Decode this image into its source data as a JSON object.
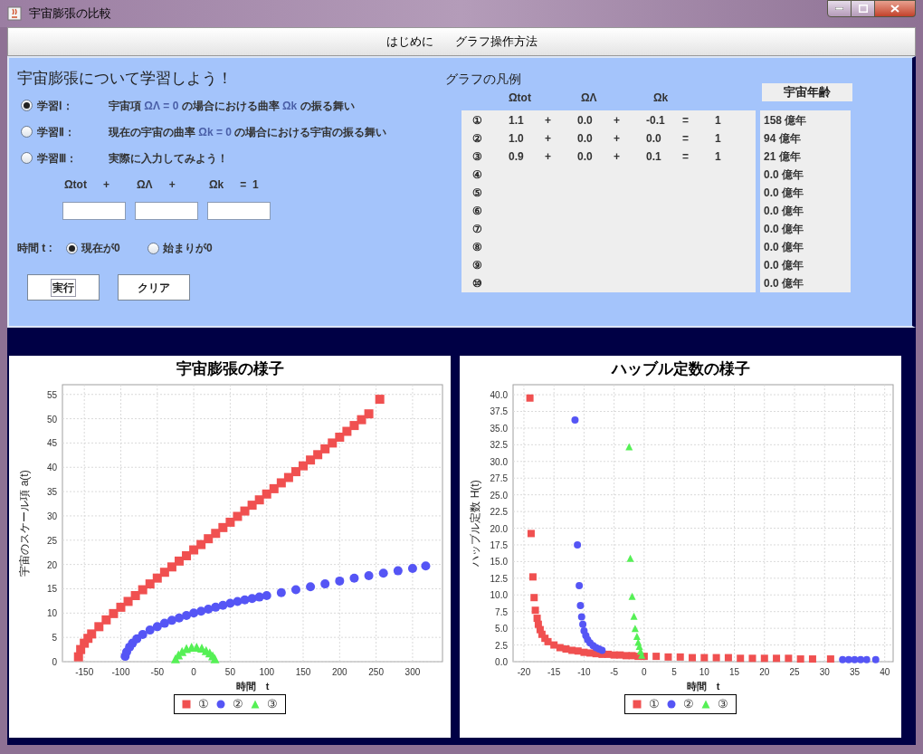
{
  "window": {
    "title": "宇宙膨張の比較"
  },
  "menu": [
    {
      "label": "はじめに"
    },
    {
      "label": "グラフ操作方法"
    }
  ],
  "study": {
    "heading": "宇宙膨張について学習しよう！",
    "lessons": [
      {
        "label": "学習Ⅰ：",
        "selected": true,
        "segments": [
          {
            "kind": "plain",
            "text": "宇宙項 "
          },
          {
            "kind": "symbol",
            "text": "ΩΛ = 0"
          },
          {
            "kind": "plain",
            "text": " の場合における曲率 "
          },
          {
            "kind": "symbol",
            "text": "Ωk"
          },
          {
            "kind": "plain",
            "text": " の振る舞い"
          }
        ]
      },
      {
        "label": "学習Ⅱ：",
        "selected": false,
        "segments": [
          {
            "kind": "plain",
            "text": "現在の宇宙の曲率 "
          },
          {
            "kind": "symbol",
            "text": "Ωk = 0"
          },
          {
            "kind": "plain",
            "text": " の場合における宇宙の振る舞い"
          }
        ]
      },
      {
        "label": "学習Ⅲ：",
        "selected": false,
        "segments": [
          {
            "kind": "plain",
            "text": "実際に入力してみよう！"
          }
        ]
      }
    ],
    "equation_labels": [
      "Ωtot",
      "+",
      "ΩΛ",
      "+",
      "Ωk",
      "=  1"
    ],
    "time_label": "時間 t :",
    "time_options": [
      {
        "label": "現在が0",
        "selected": true
      },
      {
        "label": "始まりが0",
        "selected": false
      }
    ],
    "buttons": [
      {
        "label": "実行",
        "focused": true
      },
      {
        "label": "クリア",
        "focused": false
      }
    ]
  },
  "legend": {
    "title": "グラフの凡例",
    "columns": [
      "Ωtot",
      "ΩΛ",
      "Ωk"
    ],
    "age_header": "宇宙年齢",
    "rows": [
      {
        "mark": "①",
        "terms": [
          "1.1",
          "+",
          "0.0",
          "+",
          "-0.1",
          "=",
          "1"
        ]
      },
      {
        "mark": "②",
        "terms": [
          "1.0",
          "+",
          "0.0",
          "+",
          "0.0",
          "=",
          "1"
        ]
      },
      {
        "mark": "③",
        "terms": [
          "0.9",
          "+",
          "0.0",
          "+",
          "0.1",
          "=",
          "1"
        ]
      },
      {
        "mark": "④",
        "terms": []
      },
      {
        "mark": "⑤",
        "terms": []
      },
      {
        "mark": "⑥",
        "terms": []
      },
      {
        "mark": "⑦",
        "terms": []
      },
      {
        "mark": "⑧",
        "terms": []
      },
      {
        "mark": "⑨",
        "terms": []
      },
      {
        "mark": "⑩",
        "terms": []
      }
    ],
    "ages": [
      "158 億年",
      "94 億年",
      "21 億年",
      "0.0 億年",
      "0.0 億年",
      "0.0 億年",
      "0.0 億年",
      "0.0 億年",
      "0.0 億年",
      "0.0 億年"
    ]
  },
  "charts": [
    {
      "chart_data": {
        "type": "scatter",
        "grid": true,
        "title": "宇宙膨張の様子",
        "xlabel": "時間　t",
        "ylabel": "宇宙のスケール項 a(t)",
        "xlim": [
          -180,
          341
        ],
        "ylim": [
          0,
          57
        ],
        "xticks": [
          -150,
          -100,
          -50,
          0,
          50,
          100,
          150,
          200,
          250,
          300
        ],
        "yticks": [
          0,
          5,
          10,
          15,
          20,
          25,
          30,
          35,
          40,
          45,
          50,
          55
        ],
        "series": [
          {
            "name": "①",
            "color": "#f05050",
            "marker": "square",
            "x": [
              -158,
              -155,
              -150,
              -145,
              -140,
              -130,
              -120,
              -110,
              -100,
              -90,
              -80,
              -70,
              -60,
              -50,
              -40,
              -30,
              -20,
              -10,
              0,
              10,
              20,
              30,
              40,
              50,
              60,
              70,
              80,
              90,
              100,
              110,
              120,
              130,
              140,
              150,
              160,
              170,
              180,
              190,
              200,
              210,
              220,
              230,
              240,
              255
            ],
            "values": [
              1,
              2.5,
              3.8,
              4.8,
              5.7,
              7.2,
              8.6,
              9.9,
              11.2,
              12.4,
              13.6,
              14.8,
              16,
              17.2,
              18.4,
              19.5,
              20.7,
              21.8,
              23,
              24.1,
              25.3,
              26.4,
              27.6,
              28.7,
              29.9,
              31,
              32.2,
              33.3,
              34.5,
              35.6,
              36.8,
              37.9,
              39.1,
              40.3,
              41.5,
              42.6,
              43.8,
              45,
              46.2,
              47.4,
              48.6,
              49.8,
              51,
              54
            ]
          },
          {
            "name": "②",
            "color": "#5555f5",
            "marker": "circle",
            "x": [
              -94,
              -92,
              -88,
              -84,
              -78,
              -70,
              -60,
              -50,
              -40,
              -30,
              -20,
              -10,
              0,
              10,
              20,
              30,
              40,
              50,
              60,
              70,
              80,
              90,
              100,
              120,
              140,
              160,
              180,
              200,
              220,
              240,
              260,
              280,
              300,
              318
            ],
            "values": [
              1.1,
              2,
              3,
              3.8,
              4.7,
              5.6,
              6.5,
              7.2,
              7.9,
              8.5,
              9,
              9.5,
              10,
              10.4,
              10.8,
              11.2,
              11.6,
              12,
              12.4,
              12.7,
              13,
              13.3,
              13.6,
              14.2,
              14.8,
              15.4,
              16,
              16.6,
              17.2,
              17.7,
              18.2,
              18.7,
              19.2,
              19.7
            ]
          },
          {
            "name": "③",
            "color": "#55f055",
            "marker": "triangle",
            "x": [
              -25,
              -21,
              -16,
              -10,
              -3,
              4,
              11,
              17,
              22,
              26,
              29
            ],
            "values": [
              0.6,
              1.4,
              2.1,
              2.7,
              3,
              3,
              2.8,
              2.3,
              1.8,
              1.2,
              0.6
            ]
          }
        ]
      }
    },
    {
      "chart_data": {
        "type": "scatter",
        "grid": true,
        "title": "ハッブル定数の様子",
        "xlabel": "時間　t",
        "ylabel": "ハッブル定数 H(t)",
        "xlim": [
          -21.8,
          41.4
        ],
        "ylim": [
          0,
          41.5
        ],
        "xticks": [
          -20,
          -15,
          -10,
          -5,
          0,
          5,
          10,
          15,
          20,
          25,
          30,
          35,
          40
        ],
        "yticks": [
          {
            "value": 0,
            "label": "0.0"
          },
          {
            "value": 2.5,
            "label": "2.5"
          },
          {
            "value": 5,
            "label": "5.0"
          },
          {
            "value": 7.5,
            "label": "7.5"
          },
          {
            "value": 10,
            "label": "10.0"
          },
          {
            "value": 12.5,
            "label": "12.5"
          },
          {
            "value": 15,
            "label": "15.0"
          },
          {
            "value": 17.5,
            "label": "17.5"
          },
          {
            "value": 20,
            "label": "20.0"
          },
          {
            "value": 22.5,
            "label": "22.5"
          },
          {
            "value": 25,
            "label": "25.0"
          },
          {
            "value": 27.5,
            "label": "27.5"
          },
          {
            "value": 30,
            "label": "30.0"
          },
          {
            "value": 32.5,
            "label": "32.5"
          },
          {
            "value": 35,
            "label": "35.0"
          },
          {
            "value": 37.5,
            "label": "37.5"
          },
          {
            "value": 40,
            "label": "40.0"
          }
        ],
        "series": [
          {
            "name": "①",
            "color": "#f05050",
            "marker": "square",
            "x": [
              -19,
              -18.8,
              -18.5,
              -18.3,
              -18.1,
              -17.8,
              -17.6,
              -17.3,
              -17,
              -16.5,
              -16,
              -15,
              -14,
              -13,
              -12,
              -11,
              -10,
              -9,
              -8,
              -7,
              -6,
              -5,
              -4,
              -3,
              -2,
              -1,
              0,
              2,
              4,
              6,
              8,
              10,
              12,
              14,
              16,
              18,
              20,
              22,
              24,
              26,
              28,
              31
            ],
            "values": [
              39.5,
              19.2,
              12.7,
              9.6,
              7.7,
              6.5,
              5.6,
              4.8,
              4.1,
              3.5,
              3,
              2.5,
              2.1,
              1.9,
              1.7,
              1.6,
              1.4,
              1.3,
              1.2,
              1.1,
              1.1,
              1,
              1,
              0.9,
              0.9,
              0.8,
              0.8,
              0.8,
              0.7,
              0.7,
              0.6,
              0.6,
              0.6,
              0.6,
              0.5,
              0.5,
              0.5,
              0.5,
              0.5,
              0.4,
              0.4,
              0.4
            ]
          },
          {
            "name": "②",
            "color": "#5555f5",
            "marker": "circle",
            "x": [
              -11.5,
              -11.1,
              -10.8,
              -10.6,
              -10.4,
              -10.2,
              -10,
              -9.7,
              -9.4,
              -9,
              -8.5,
              -8,
              -7.5,
              -7,
              33,
              34,
              35,
              36,
              37,
              38.5
            ],
            "values": [
              36.2,
              17.5,
              11.4,
              8.4,
              6.7,
              5.6,
              4.6,
              3.9,
              3.3,
              2.8,
              2.4,
              2.1,
              1.9,
              1.7,
              0.3,
              0.3,
              0.3,
              0.3,
              0.3,
              0.3
            ]
          },
          {
            "name": "③",
            "color": "#55f055",
            "marker": "triangle",
            "x": [
              -2.5,
              -2.3,
              -2,
              -1.7,
              -1.5,
              -1.2,
              -1,
              -0.8,
              -0.6,
              -0.4
            ],
            "values": [
              32.2,
              15.5,
              9.8,
              6.8,
              5,
              3.8,
              2.9,
              2.3,
              1.6,
              1
            ]
          }
        ]
      }
    }
  ]
}
